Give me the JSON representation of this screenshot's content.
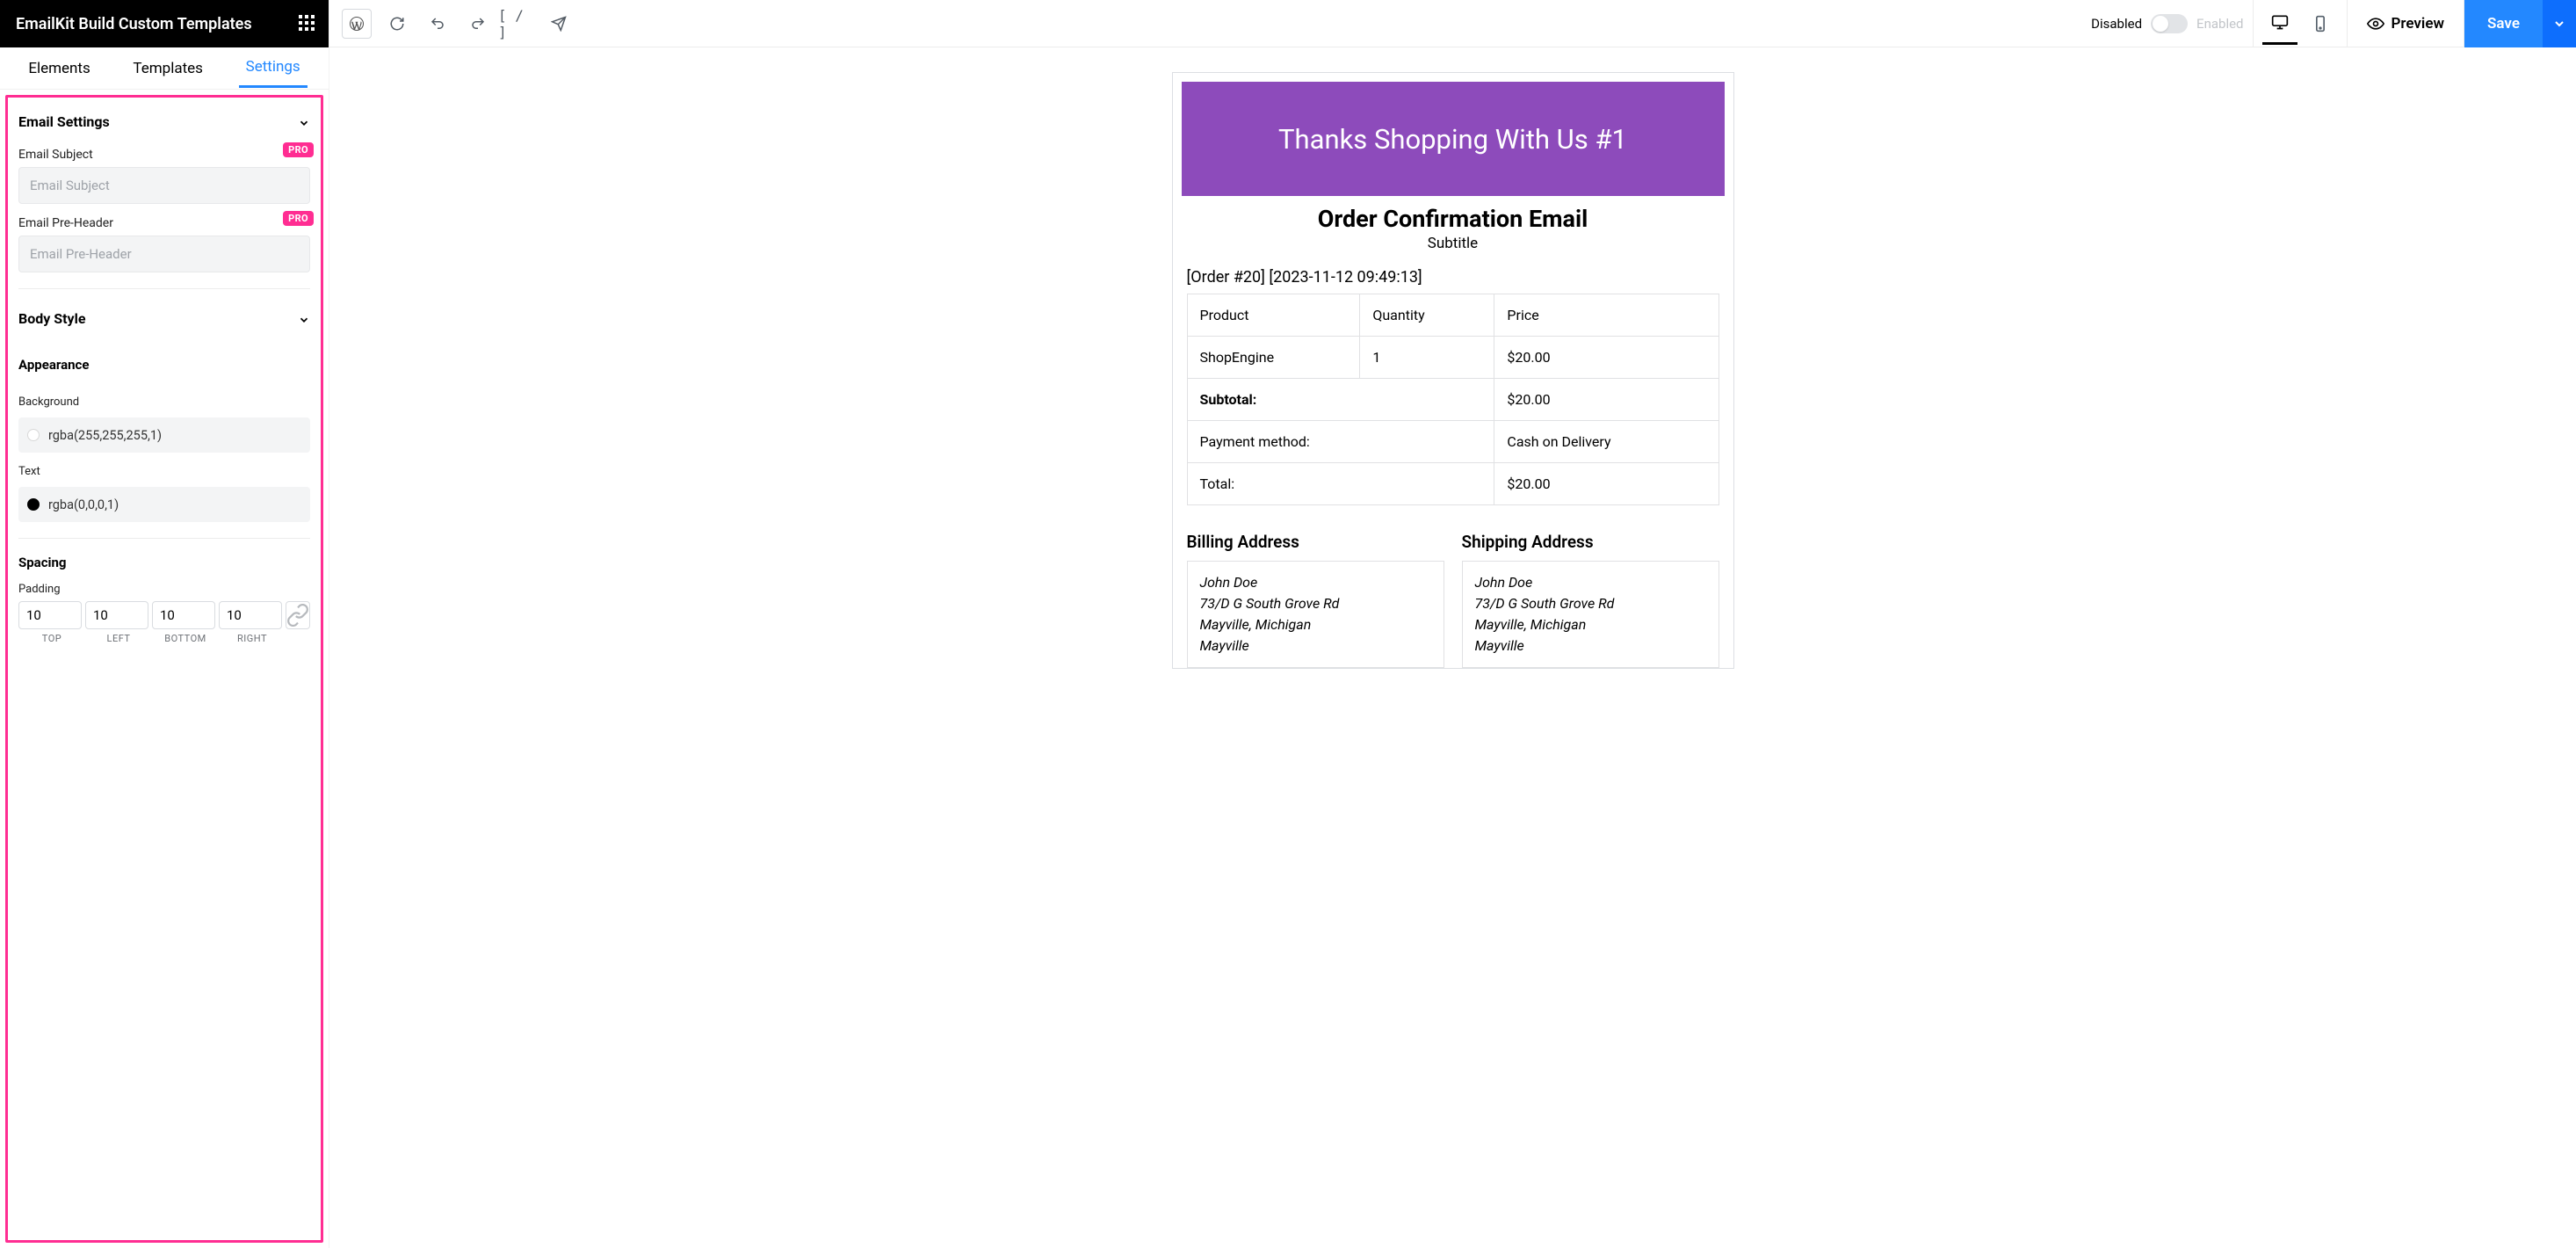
{
  "brand": "EmailKit Build Custom Templates",
  "tabs": {
    "elements": "Elements",
    "templates": "Templates",
    "settings": "Settings"
  },
  "settings_panel": {
    "email_settings_title": "Email Settings",
    "subject": {
      "label": "Email Subject",
      "placeholder": "Email Subject",
      "badge": "PRO"
    },
    "preheader": {
      "label": "Email Pre-Header",
      "placeholder": "Email Pre-Header",
      "badge": "PRO"
    },
    "body_style_title": "Body Style",
    "appearance_title": "Appearance",
    "background": {
      "label": "Background",
      "value": "rgba(255,255,255,1)"
    },
    "text": {
      "label": "Text",
      "value": "rgba(0,0,0,1)"
    },
    "spacing_title": "Spacing",
    "padding": {
      "label": "Padding",
      "top": "10",
      "left": "10",
      "bottom": "10",
      "right": "10",
      "lbl_top": "TOP",
      "lbl_left": "LEFT",
      "lbl_bottom": "BOTTOM",
      "lbl_right": "RIGHT"
    }
  },
  "toolbar": {
    "short_code": "[ / ]",
    "disabled": "Disabled",
    "enabled": "Enabled",
    "preview": "Preview",
    "save": "Save"
  },
  "email": {
    "hero": "Thanks Shopping With Us #1",
    "title": "Order Confirmation Email",
    "subtitle": "Subtitle",
    "order_line": "[Order #20] [2023-11-12 09:49:13]",
    "head": {
      "product": "Product",
      "quantity": "Quantity",
      "price": "Price"
    },
    "row1": {
      "product": "ShopEngine",
      "quantity": "1",
      "price": "$20.00"
    },
    "subtotal": {
      "label": "Subtotal:",
      "value": "$20.00"
    },
    "payment": {
      "label": "Payment method:",
      "value": "Cash on Delivery"
    },
    "total": {
      "label": "Total:",
      "value": "$20.00"
    },
    "billing": {
      "title": "Billing Address",
      "name": "John Doe",
      "addr": "73/D G South Grove Rd",
      "city": "Mayville, Michigan",
      "region": "Mayville"
    },
    "shipping": {
      "title": "Shipping Address",
      "name": "John Doe",
      "addr": "73/D G South Grove Rd",
      "city": "Mayville, Michigan",
      "region": "Mayville"
    }
  }
}
